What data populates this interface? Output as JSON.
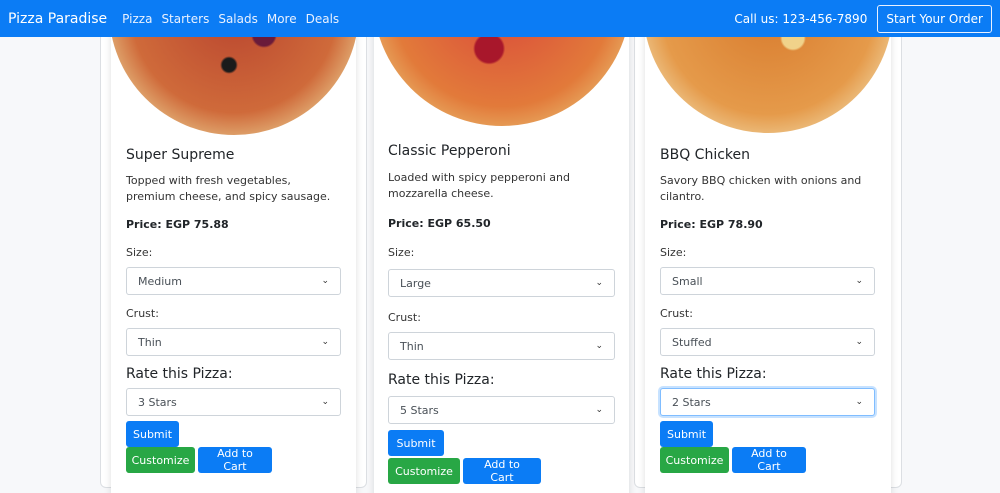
{
  "navbar": {
    "brand": "Pizza Paradise",
    "links": [
      "Pizza",
      "Starters",
      "Salads",
      "More",
      "Deals"
    ],
    "call": "Call us: 123-456-7890",
    "order_button": "Start Your Order"
  },
  "cards": [
    {
      "title": "Super Supreme",
      "description": "Topped with fresh vegetables, premium cheese, and spicy sausage.",
      "price": "Price: EGP 75.88",
      "size_label": "Size:",
      "size_value": "Medium",
      "crust_label": "Crust:",
      "crust_value": "Thin",
      "rate_label": "Rate this Pizza:",
      "rating_value": "3 Stars",
      "submit": "Submit",
      "customize": "Customize",
      "add_to_cart": "Add to Cart"
    },
    {
      "title": "Classic Pepperoni",
      "description": "Loaded with spicy pepperoni and mozzarella cheese.",
      "price": "Price: EGP 65.50",
      "size_label": "Size:",
      "size_value": "Large",
      "crust_label": "Crust:",
      "crust_value": "Thin",
      "rate_label": "Rate this Pizza:",
      "rating_value": "5 Stars",
      "submit": "Submit",
      "customize": "Customize",
      "add_to_cart": "Add to Cart"
    },
    {
      "title": "BBQ Chicken",
      "description": "Savory BBQ chicken with onions and cilantro.",
      "price": "Price: EGP 78.90",
      "size_label": "Size:",
      "size_value": "Small",
      "crust_label": "Crust:",
      "crust_value": "Stuffed",
      "rate_label": "Rate this Pizza:",
      "rating_value": "2 Stars",
      "submit": "Submit",
      "customize": "Customize",
      "add_to_cart": "Add to Cart"
    }
  ],
  "colors": {
    "primary": "#0b7cf5",
    "success": "#28a745"
  },
  "icons": {
    "select_arrow": "chevron-down-icon",
    "pizza_image": "pizza-image"
  }
}
